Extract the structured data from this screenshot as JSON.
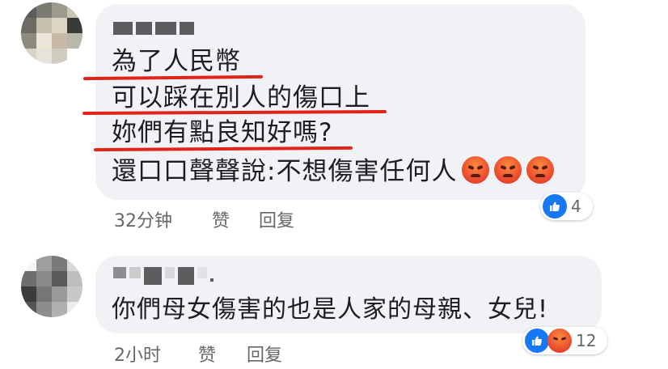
{
  "comments": [
    {
      "lines": [
        "為了人民幣",
        "可以踩在別人的傷口上",
        "妳們有點良知好嗎?",
        "還口口聲聲說:不想傷害任何人"
      ],
      "emoji": "angry-emoji",
      "time": "32分钟",
      "like_label": "赞",
      "reply_label": "回复",
      "reactions": [
        "like-icon"
      ],
      "reaction_count": "4"
    },
    {
      "lines": [
        "你們母女傷害的也是人家的母親、女兒!"
      ],
      "time": "2小时",
      "like_label": "赞",
      "reply_label": "回复",
      "reactions": [
        "like-icon",
        "angry-icon"
      ],
      "reaction_count": "12"
    }
  ],
  "colors": {
    "underline": "#e2231a",
    "bubble": "#f0f2f5",
    "like_blue": "#1877f2",
    "meta_text": "#65676b"
  }
}
